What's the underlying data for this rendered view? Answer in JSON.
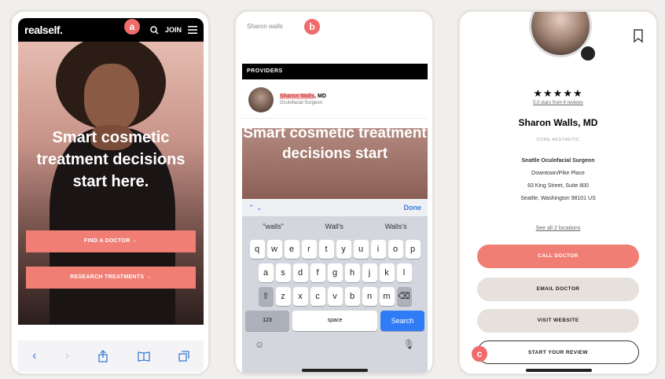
{
  "markers": {
    "a": "a",
    "b": "b",
    "c": "c"
  },
  "phone1": {
    "logo": "realself.",
    "join_label": "JOIN",
    "headline": "Smart cosmetic treatment decisions start here.",
    "cta_find": "FIND A DOCTOR →",
    "cta_research": "RESEARCH TREATMENTS →",
    "icons": [
      "back-icon",
      "forward-icon",
      "share-icon",
      "bookmarks-icon",
      "tabs-icon"
    ]
  },
  "phone2": {
    "search_value": "Sharon walls",
    "providers_header": "PROVIDERS",
    "provider_name_highlight": "Sharon Walls",
    "provider_name_suffix": ", MD",
    "provider_title": "Oculofacial Surgeon",
    "hero_text": "Smart cosmetic treatment decisions start",
    "done_label": "Done",
    "suggestions": [
      "\"walls\"",
      "Wall's",
      "Walls's"
    ],
    "row1": [
      "q",
      "w",
      "e",
      "r",
      "t",
      "y",
      "u",
      "i",
      "o",
      "p"
    ],
    "row2": [
      "a",
      "s",
      "d",
      "f",
      "g",
      "h",
      "j",
      "k",
      "l"
    ],
    "row3": [
      "z",
      "x",
      "c",
      "v",
      "b",
      "n",
      "m"
    ],
    "numbers_label": "123",
    "space_label": "space",
    "search_label": "Search"
  },
  "phone3": {
    "stars": "★★★★★",
    "rating_link": "5.0 stars from 4 reviews",
    "doctor_name": "Sharon Walls, MD",
    "practice": "CORE AESTHETIC",
    "specialty": "Seattle Oculofacial Surgeon",
    "addr1": "Downtown/Pike Place",
    "addr2": "83 King Street, Suite 800",
    "addr3": "Seattle, Washington 98101 US",
    "see_all": "See all 2 locations",
    "call_label": "CALL DOCTOR",
    "email_label": "EMAIL DOCTOR",
    "visit_label": "VISIT WEBSITE",
    "review_label": "START YOUR REVIEW"
  },
  "colors": {
    "accent": "#f07e74",
    "marker": "#f06b6b",
    "ios_blue": "#2f7cf6"
  }
}
